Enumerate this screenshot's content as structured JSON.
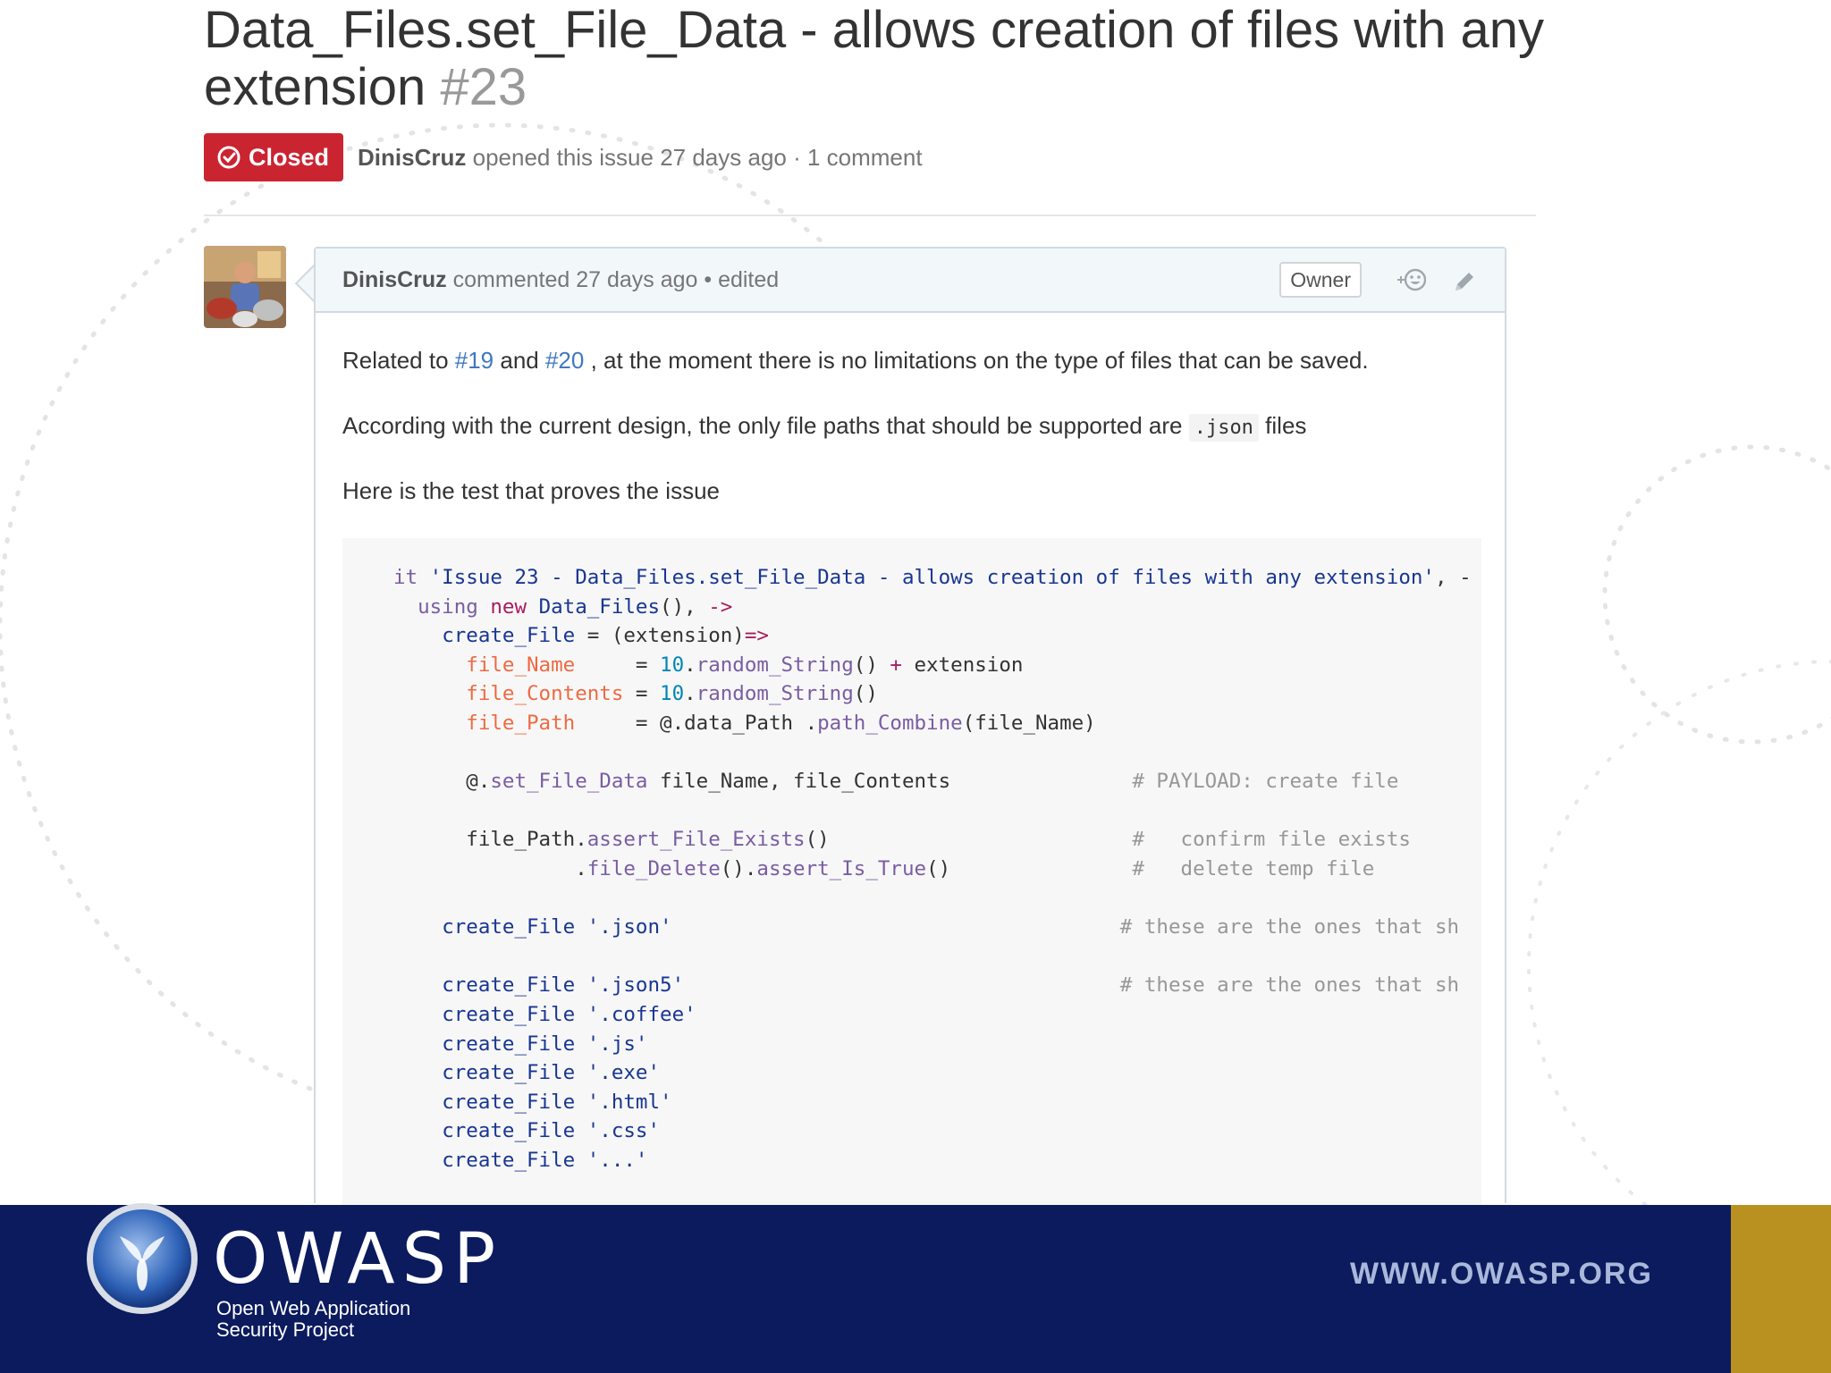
{
  "issue": {
    "title": "Data_Files.set_File_Data - allows creation of files with any extension",
    "number": "#23",
    "state": "Closed",
    "author": "DinisCruz",
    "opened_text": "opened this issue 27 days ago · 1 comment"
  },
  "comment": {
    "author": "DinisCruz",
    "meta": "commented 27 days ago • edited",
    "role_badge": "Owner",
    "reaction_icon": "add-reaction-icon",
    "edit_icon": "pencil-icon",
    "p1": {
      "lead": "Related to ",
      "link1": "#19",
      "mid": " and ",
      "link2": "#20",
      "tail": " , at the moment there is no limitations on the type of files that can be saved."
    },
    "p2": {
      "lead": "According with the current design, the only file paths that should be supported are ",
      "code": ".json",
      "tail": " files"
    },
    "p3": "Here is the test that proves the issue"
  },
  "code_lines": [
    [
      [
        "it ",
        "kw"
      ],
      [
        "'Issue 23 - Data_Files.set_File_Data - allows creation of files with any extension'",
        "str"
      ],
      [
        ", -",
        ""
      ]
    ],
    [
      [
        "  ",
        ""
      ],
      [
        "using",
        "kw"
      ],
      [
        " ",
        ""
      ],
      [
        "new",
        "ar"
      ],
      [
        " ",
        ""
      ],
      [
        "Data_Files",
        "str"
      ],
      [
        "(), ",
        ""
      ],
      [
        "->",
        "ar"
      ]
    ],
    [
      [
        "    ",
        ""
      ],
      [
        "create_File",
        "str"
      ],
      [
        " = (extension)",
        ""
      ],
      [
        "=>",
        "ar"
      ]
    ],
    [
      [
        "      ",
        ""
      ],
      [
        "file_Name",
        "vr"
      ],
      [
        "     = ",
        ""
      ],
      [
        "10",
        "nm"
      ],
      [
        ".",
        ""
      ],
      [
        "random_String",
        "fn"
      ],
      [
        "() ",
        ""
      ],
      [
        "+",
        "ar"
      ],
      [
        " extension",
        ""
      ]
    ],
    [
      [
        "      ",
        ""
      ],
      [
        "file_Contents",
        "vr"
      ],
      [
        " = ",
        ""
      ],
      [
        "10",
        "nm"
      ],
      [
        ".",
        ""
      ],
      [
        "random_String",
        "fn"
      ],
      [
        "()",
        ""
      ]
    ],
    [
      [
        "      ",
        ""
      ],
      [
        "file_Path",
        "vr"
      ],
      [
        "     = @.data_Path .",
        ""
      ],
      [
        "path_Combine",
        "fn"
      ],
      [
        "(file_Name)",
        ""
      ]
    ],
    [
      [
        "",
        ""
      ]
    ],
    [
      [
        "      @.",
        ""
      ],
      [
        "set_File_Data",
        "fn"
      ],
      [
        " file_Name, file_Contents               ",
        ""
      ],
      [
        "# PAYLOAD: create file",
        "cm"
      ]
    ],
    [
      [
        "",
        ""
      ]
    ],
    [
      [
        "      file_Path.",
        ""
      ],
      [
        "assert_File_Exists",
        "fn"
      ],
      [
        "()                         ",
        ""
      ],
      [
        "#   confirm file exists",
        "cm"
      ]
    ],
    [
      [
        "               .",
        ""
      ],
      [
        "file_Delete",
        "fn"
      ],
      [
        "().",
        ""
      ],
      [
        "assert_Is_True",
        "fn"
      ],
      [
        "()               ",
        ""
      ],
      [
        "#   delete temp file",
        "cm"
      ]
    ],
    [
      [
        "",
        ""
      ]
    ],
    [
      [
        "    ",
        ""
      ],
      [
        "create_File",
        "str"
      ],
      [
        " ",
        ""
      ],
      [
        "'.json'",
        "str"
      ],
      [
        "                                     ",
        ""
      ],
      [
        "# these are the ones that sh",
        "cm"
      ]
    ],
    [
      [
        "",
        ""
      ]
    ],
    [
      [
        "    ",
        ""
      ],
      [
        "create_File",
        "str"
      ],
      [
        " ",
        ""
      ],
      [
        "'.json5'",
        "str"
      ],
      [
        "                                    ",
        ""
      ],
      [
        "# these are the ones that sh",
        "cm"
      ]
    ],
    [
      [
        "    ",
        ""
      ],
      [
        "create_File",
        "str"
      ],
      [
        " ",
        ""
      ],
      [
        "'.coffee'",
        "str"
      ]
    ],
    [
      [
        "    ",
        ""
      ],
      [
        "create_File",
        "str"
      ],
      [
        " ",
        ""
      ],
      [
        "'.js'",
        "str"
      ]
    ],
    [
      [
        "    ",
        ""
      ],
      [
        "create_File",
        "str"
      ],
      [
        " ",
        ""
      ],
      [
        "'.exe'",
        "str"
      ]
    ],
    [
      [
        "    ",
        ""
      ],
      [
        "create_File",
        "str"
      ],
      [
        " ",
        ""
      ],
      [
        "'.html'",
        "str"
      ]
    ],
    [
      [
        "    ",
        ""
      ],
      [
        "create_File",
        "str"
      ],
      [
        " ",
        ""
      ],
      [
        "'.css'",
        "str"
      ]
    ],
    [
      [
        "    ",
        ""
      ],
      [
        "create_File",
        "str"
      ],
      [
        " ",
        ""
      ],
      [
        "'...'",
        "str"
      ]
    ]
  ],
  "footer": {
    "brand": "OWASP",
    "subtitle_line1": "Open Web Application",
    "subtitle_line2": "Security Project",
    "url": "WWW.OWASP.ORG",
    "logo_icon": "owasp-wasp-logo-icon"
  },
  "colors": {
    "closed_badge": "#cb2431",
    "link": "#4078c0",
    "footer_bg": "#0b1b5e",
    "footer_gold": "#b99120"
  }
}
